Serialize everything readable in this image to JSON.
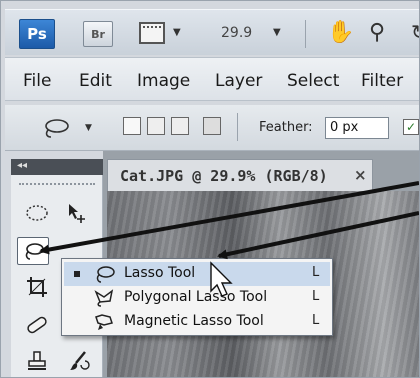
{
  "app": {
    "ps_label": "Ps",
    "br_label": "Br",
    "zoom_value": "29.9",
    "dropdown_glyph": "▼"
  },
  "menubar": {
    "items": [
      "File",
      "Edit",
      "Image",
      "Layer",
      "Select",
      "Filter"
    ]
  },
  "options": {
    "feather_label": "Feather:",
    "feather_value": "0 px",
    "checkbox_glyph": "✓"
  },
  "tools": {
    "collapse_glyph": "◂◂"
  },
  "document": {
    "tab_title": "Cat.JPG @ 29.9% (RGB/8)",
    "close_glyph": "×"
  },
  "flyout": {
    "items": [
      {
        "label": "Lasso Tool",
        "shortcut": "L",
        "icon": "lasso-icon"
      },
      {
        "label": "Polygonal Lasso Tool",
        "shortcut": "L",
        "icon": "polygonal-lasso-icon"
      },
      {
        "label": "Magnetic Lasso Tool",
        "shortcut": "L",
        "icon": "magnetic-lasso-icon"
      }
    ]
  },
  "colors": {
    "ps_blue": "#1c5aa8",
    "selection": "#c9d9ec",
    "arrow": "#111111"
  }
}
